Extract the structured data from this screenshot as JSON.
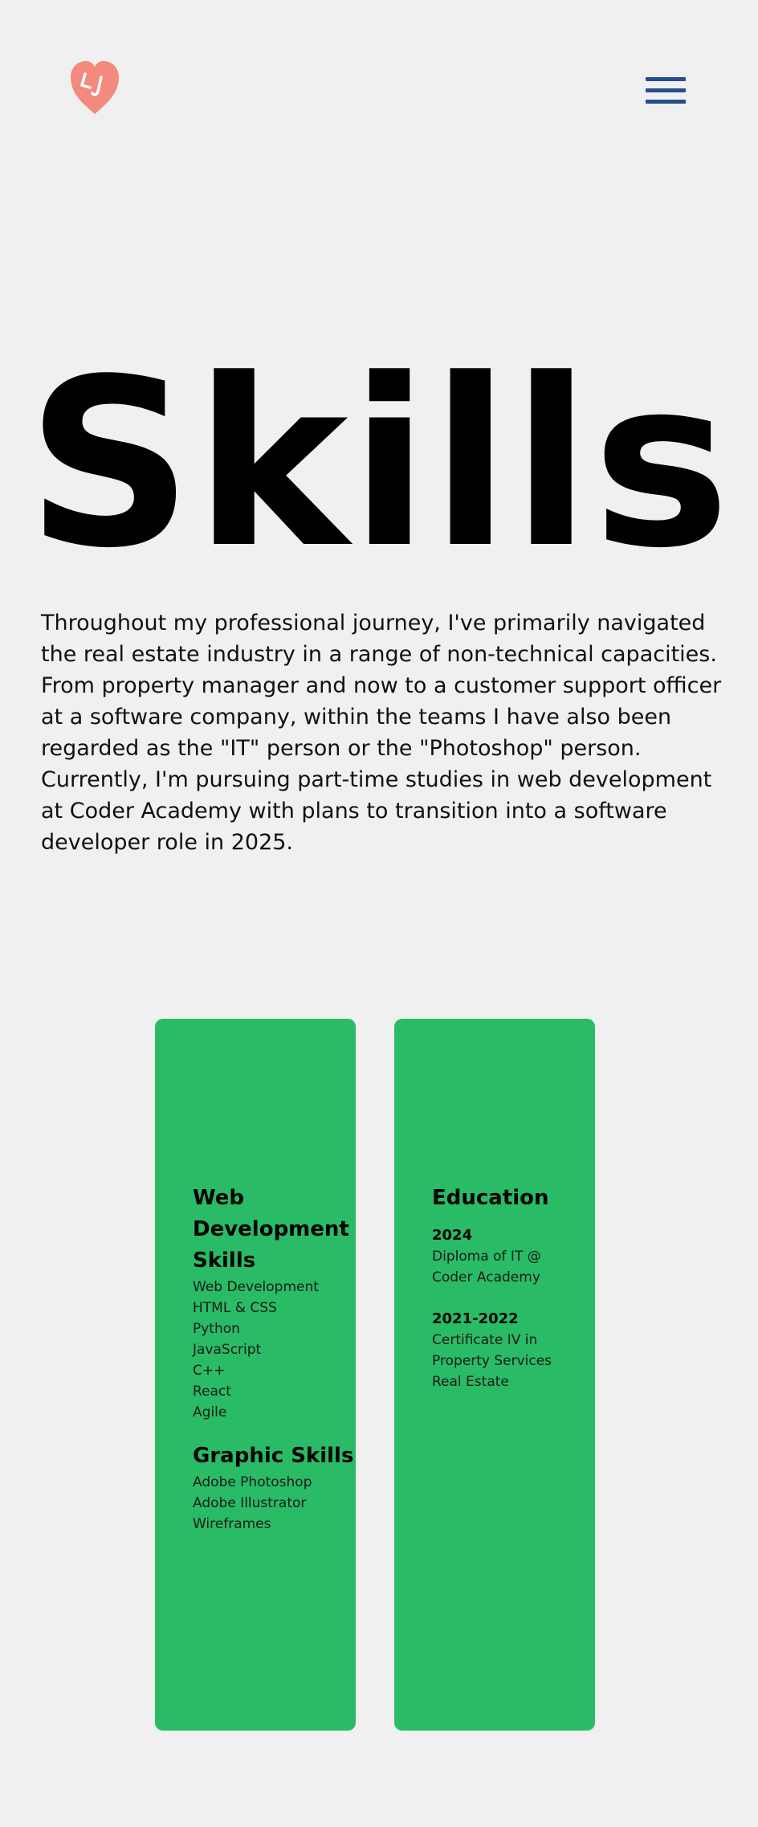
{
  "header": {
    "logo_icon": "heart-face-logo",
    "logo_color": "#f38a7d",
    "menu_icon": "hamburger-menu-icon",
    "menu_color": "#254f8e"
  },
  "page": {
    "title": "Skills",
    "intro": [
      "Throughout my professional journey, I've primarily navigated the real estate industry in a range of non-technical capacities. From property manager and now to a customer support officer at a software company, within the teams I have also been regarded as the \"IT\" person or the \"Photoshop\" person.",
      "Currently, I'm pursuing part-time studies in web development at Coder Academy with plans to transition into a software developer role in 2025."
    ]
  },
  "cards": {
    "color": "#29bb65",
    "skills": {
      "web_heading": "Web Development Skills",
      "web_items": [
        "Web Development",
        "HTML & CSS",
        "Python",
        "JavaScript",
        "C++",
        "React",
        "Agile"
      ],
      "graphic_heading": "Graphic Skills",
      "graphic_items": [
        "Adobe Photoshop",
        "Adobe Illustrator",
        "Wireframes"
      ]
    },
    "education": {
      "heading": "Education",
      "entries": [
        {
          "year": "2024",
          "lines": [
            "Diploma of IT @",
            "Coder Academy"
          ]
        },
        {
          "year": "2021-2022",
          "lines": [
            "Certificate IV in",
            "Property Services",
            "Real Estate"
          ]
        }
      ]
    }
  }
}
